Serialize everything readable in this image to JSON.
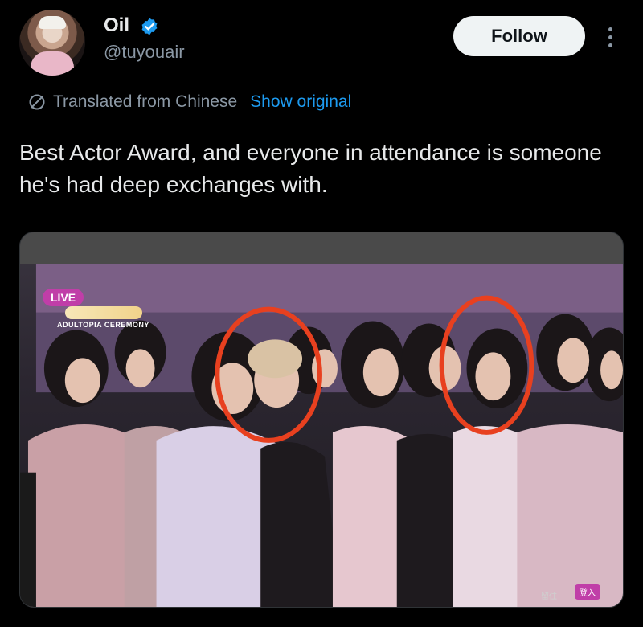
{
  "header": {
    "name": "Oil",
    "handle": "@tuyouair",
    "follow_label": "Follow"
  },
  "translation": {
    "label": "Translated from Chinese",
    "show_original": "Show original"
  },
  "tweet": {
    "text": "Best Actor Award, and everyone in attendance is someone he's had deep exchanges with."
  },
  "media": {
    "live_badge": "LIVE",
    "ceremony_label": "ADULTOPIA CEREMONY",
    "corner_tag": "登入",
    "corner_tag2": "留住"
  },
  "colors": {
    "accent": "#1d9bf0",
    "background": "#000000",
    "text_primary": "#e7e9ea",
    "text_secondary": "#8b98a5",
    "annotation_circle": "#e8401f"
  },
  "icons": {
    "verified": "verified-badge-icon",
    "globe": "translate-globe-icon",
    "more": "more-options-icon"
  }
}
